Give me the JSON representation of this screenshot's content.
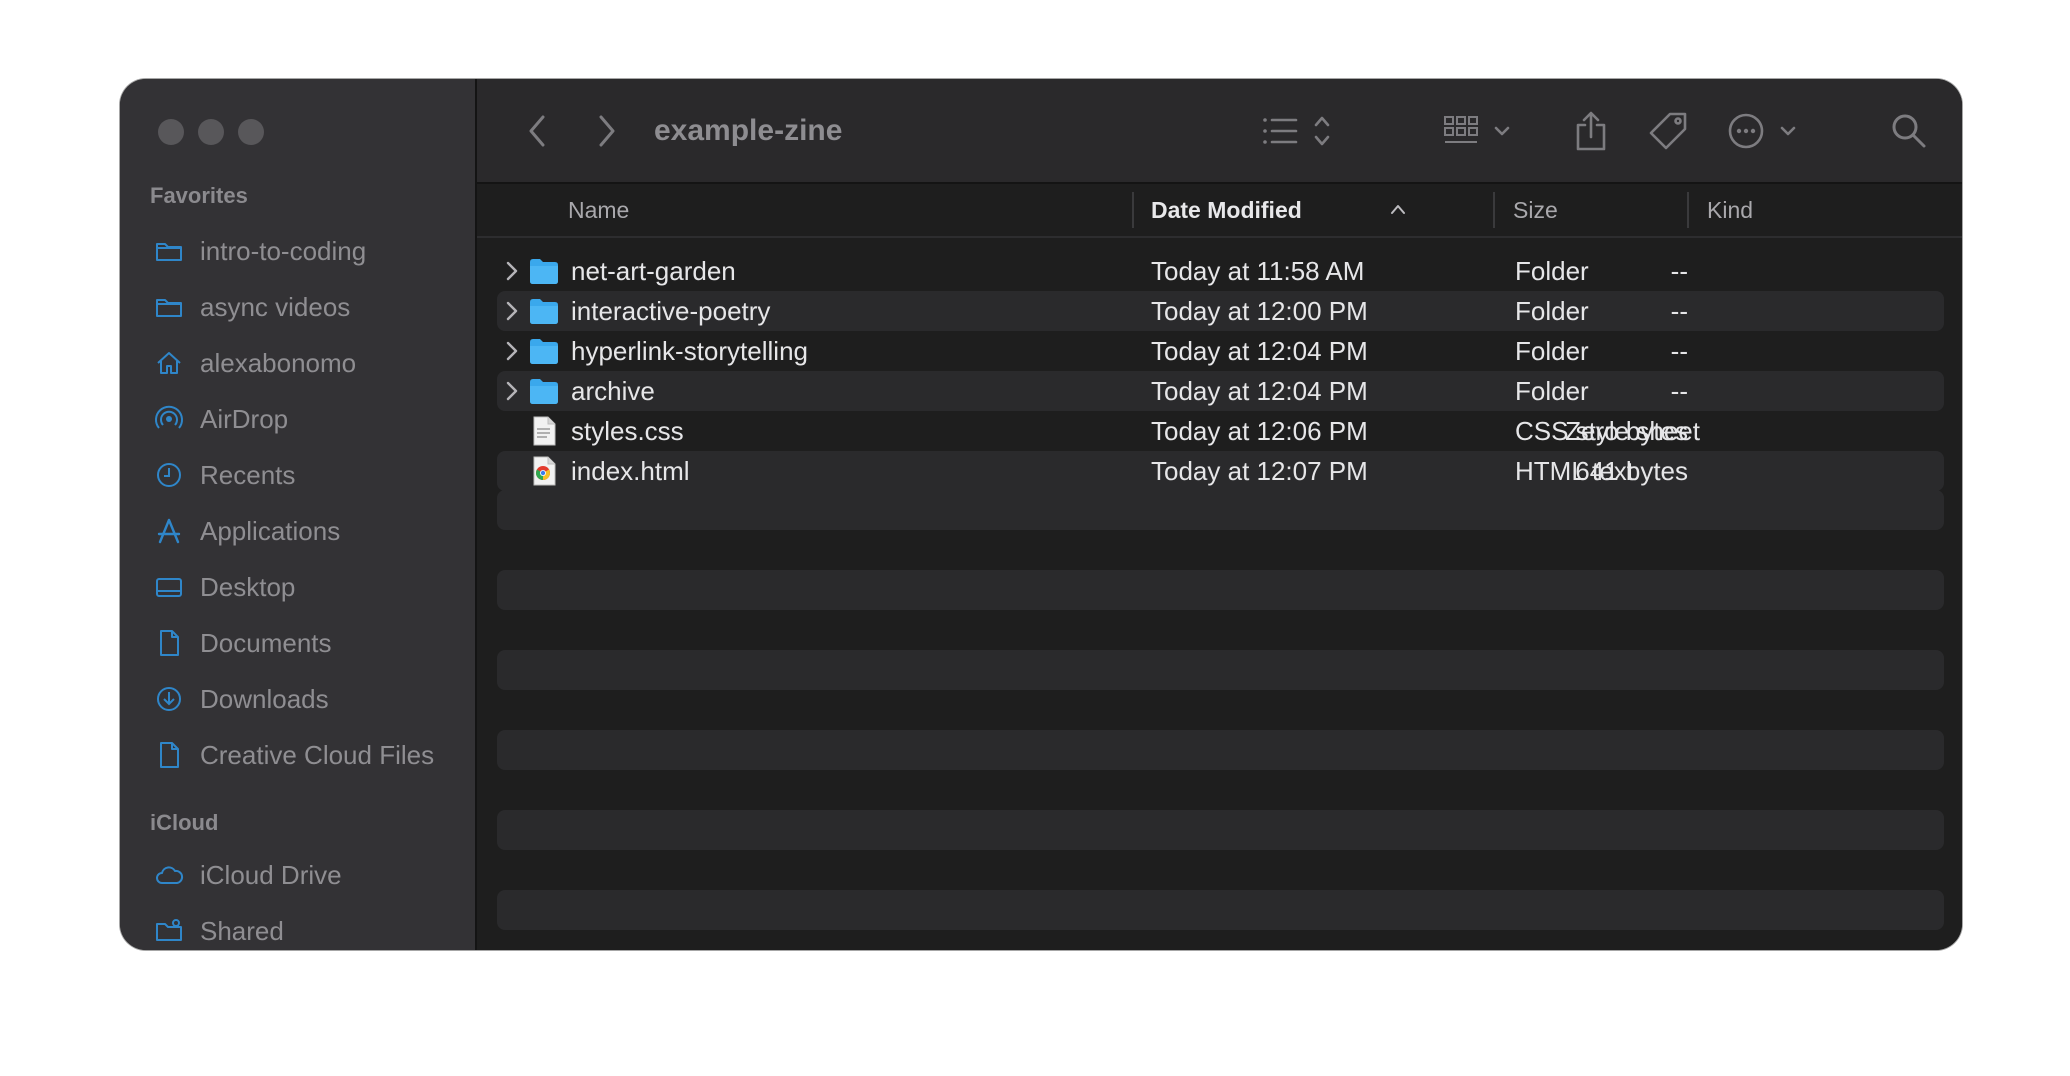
{
  "window": {
    "title": "example-zine"
  },
  "sidebar": {
    "favorites_title": "Favorites",
    "favorites": [
      {
        "label": "intro-to-coding",
        "icon": "folder-icon"
      },
      {
        "label": "async videos",
        "icon": "folder-icon"
      },
      {
        "label": "alexabonomo",
        "icon": "home-icon"
      },
      {
        "label": "AirDrop",
        "icon": "airdrop-icon"
      },
      {
        "label": "Recents",
        "icon": "clock-icon"
      },
      {
        "label": "Applications",
        "icon": "applications-icon"
      },
      {
        "label": "Desktop",
        "icon": "desktop-icon"
      },
      {
        "label": "Documents",
        "icon": "document-icon"
      },
      {
        "label": "Downloads",
        "icon": "download-icon"
      },
      {
        "label": "Creative Cloud Files",
        "icon": "file-icon"
      }
    ],
    "icloud_title": "iCloud",
    "icloud": [
      {
        "label": "iCloud Drive",
        "icon": "cloud-icon"
      },
      {
        "label": "Shared",
        "icon": "shared-folder-icon"
      }
    ]
  },
  "columns": {
    "name": "Name",
    "date": "Date Modified",
    "size": "Size",
    "kind": "Kind"
  },
  "files": [
    {
      "name": "net-art-garden",
      "date": "Today at 11:58 AM",
      "size": "--",
      "kind": "Folder",
      "type": "folder"
    },
    {
      "name": "interactive-poetry",
      "date": "Today at 12:00 PM",
      "size": "--",
      "kind": "Folder",
      "type": "folder"
    },
    {
      "name": "hyperlink-storytelling",
      "date": "Today at 12:04 PM",
      "size": "--",
      "kind": "Folder",
      "type": "folder"
    },
    {
      "name": "archive",
      "date": "Today at 12:04 PM",
      "size": "--",
      "kind": "Folder",
      "type": "folder"
    },
    {
      "name": "styles.css",
      "date": "Today at 12:06 PM",
      "size": "Zero bytes",
      "kind": "CSS style sheet",
      "type": "css"
    },
    {
      "name": "index.html",
      "date": "Today at 12:07 PM",
      "size": "641 bytes",
      "kind": "HTML text",
      "type": "html"
    }
  ],
  "colors": {
    "sidebar_bg": "#333235",
    "content_bg": "#1e1e1e",
    "folder_blue": "#3aa8ec",
    "sidebar_icon": "#2f86c9"
  }
}
